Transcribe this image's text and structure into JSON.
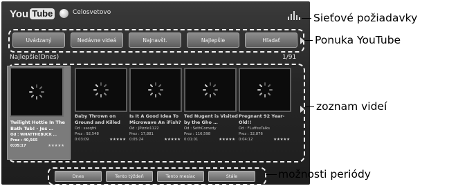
{
  "header": {
    "logo_you": "You",
    "logo_tube": "Tube",
    "region_label": "Celosvetovo"
  },
  "menu": {
    "items": [
      {
        "label": "Uvádzaný"
      },
      {
        "label": "Nedávne videá"
      },
      {
        "label": "Najnavšt."
      },
      {
        "label": "Najlepšie"
      },
      {
        "label": "Hľadať"
      }
    ]
  },
  "video_list": {
    "section_title": "Najlepšie(Dnes)",
    "page_indicator": "1/91",
    "videos": [
      {
        "title": "Twilight Hottie In The Bath Tub! - Jes …",
        "author": "Od : WHATTHEBUCK …",
        "views": "Prez : 40,565",
        "duration": "0:05:17",
        "stars": "★★★★★"
      },
      {
        "title": "Baby Thrown on Ground and Killed",
        "author": "Od : sseqfnl",
        "views": "Prez : 92,548",
        "duration": "0:03:09",
        "stars": "★★★★★"
      },
      {
        "title": "Is It A Good Idea To Microwave An iFish?",
        "author": "Od : JPizzle1122",
        "views": "Prez : 17,881",
        "duration": "0:05:24",
        "stars": "★★★★★"
      },
      {
        "title": "Ted Nugent is Visited by the Gho …",
        "author": "Od : SethComedy",
        "views": "Prez : 116,598",
        "duration": "0:01:01",
        "stars": "★★★★★"
      },
      {
        "title": "Pregnant 92 Year-Old!!",
        "author": "Od : FLuffeeTalks",
        "views": "Prez : 32,876",
        "duration": "0:04:12",
        "stars": "★★★★★"
      }
    ]
  },
  "period_options": {
    "items": [
      {
        "label": "Dnes"
      },
      {
        "label": "Tento týždeň"
      },
      {
        "label": "Tento mesiac"
      },
      {
        "label": "Stále"
      }
    ]
  },
  "callouts": {
    "network_requests": "Sieťové požiadavky",
    "youtube_menu": "Ponuka YouTube",
    "video_list": "zoznam videí",
    "period_options": "možnosti periódy"
  },
  "icons": {
    "globe": "globe-icon",
    "signal": "signal-strength-icon",
    "spinner": "loading-spinner-icon",
    "scroll_right": "chevron-right-icon"
  }
}
